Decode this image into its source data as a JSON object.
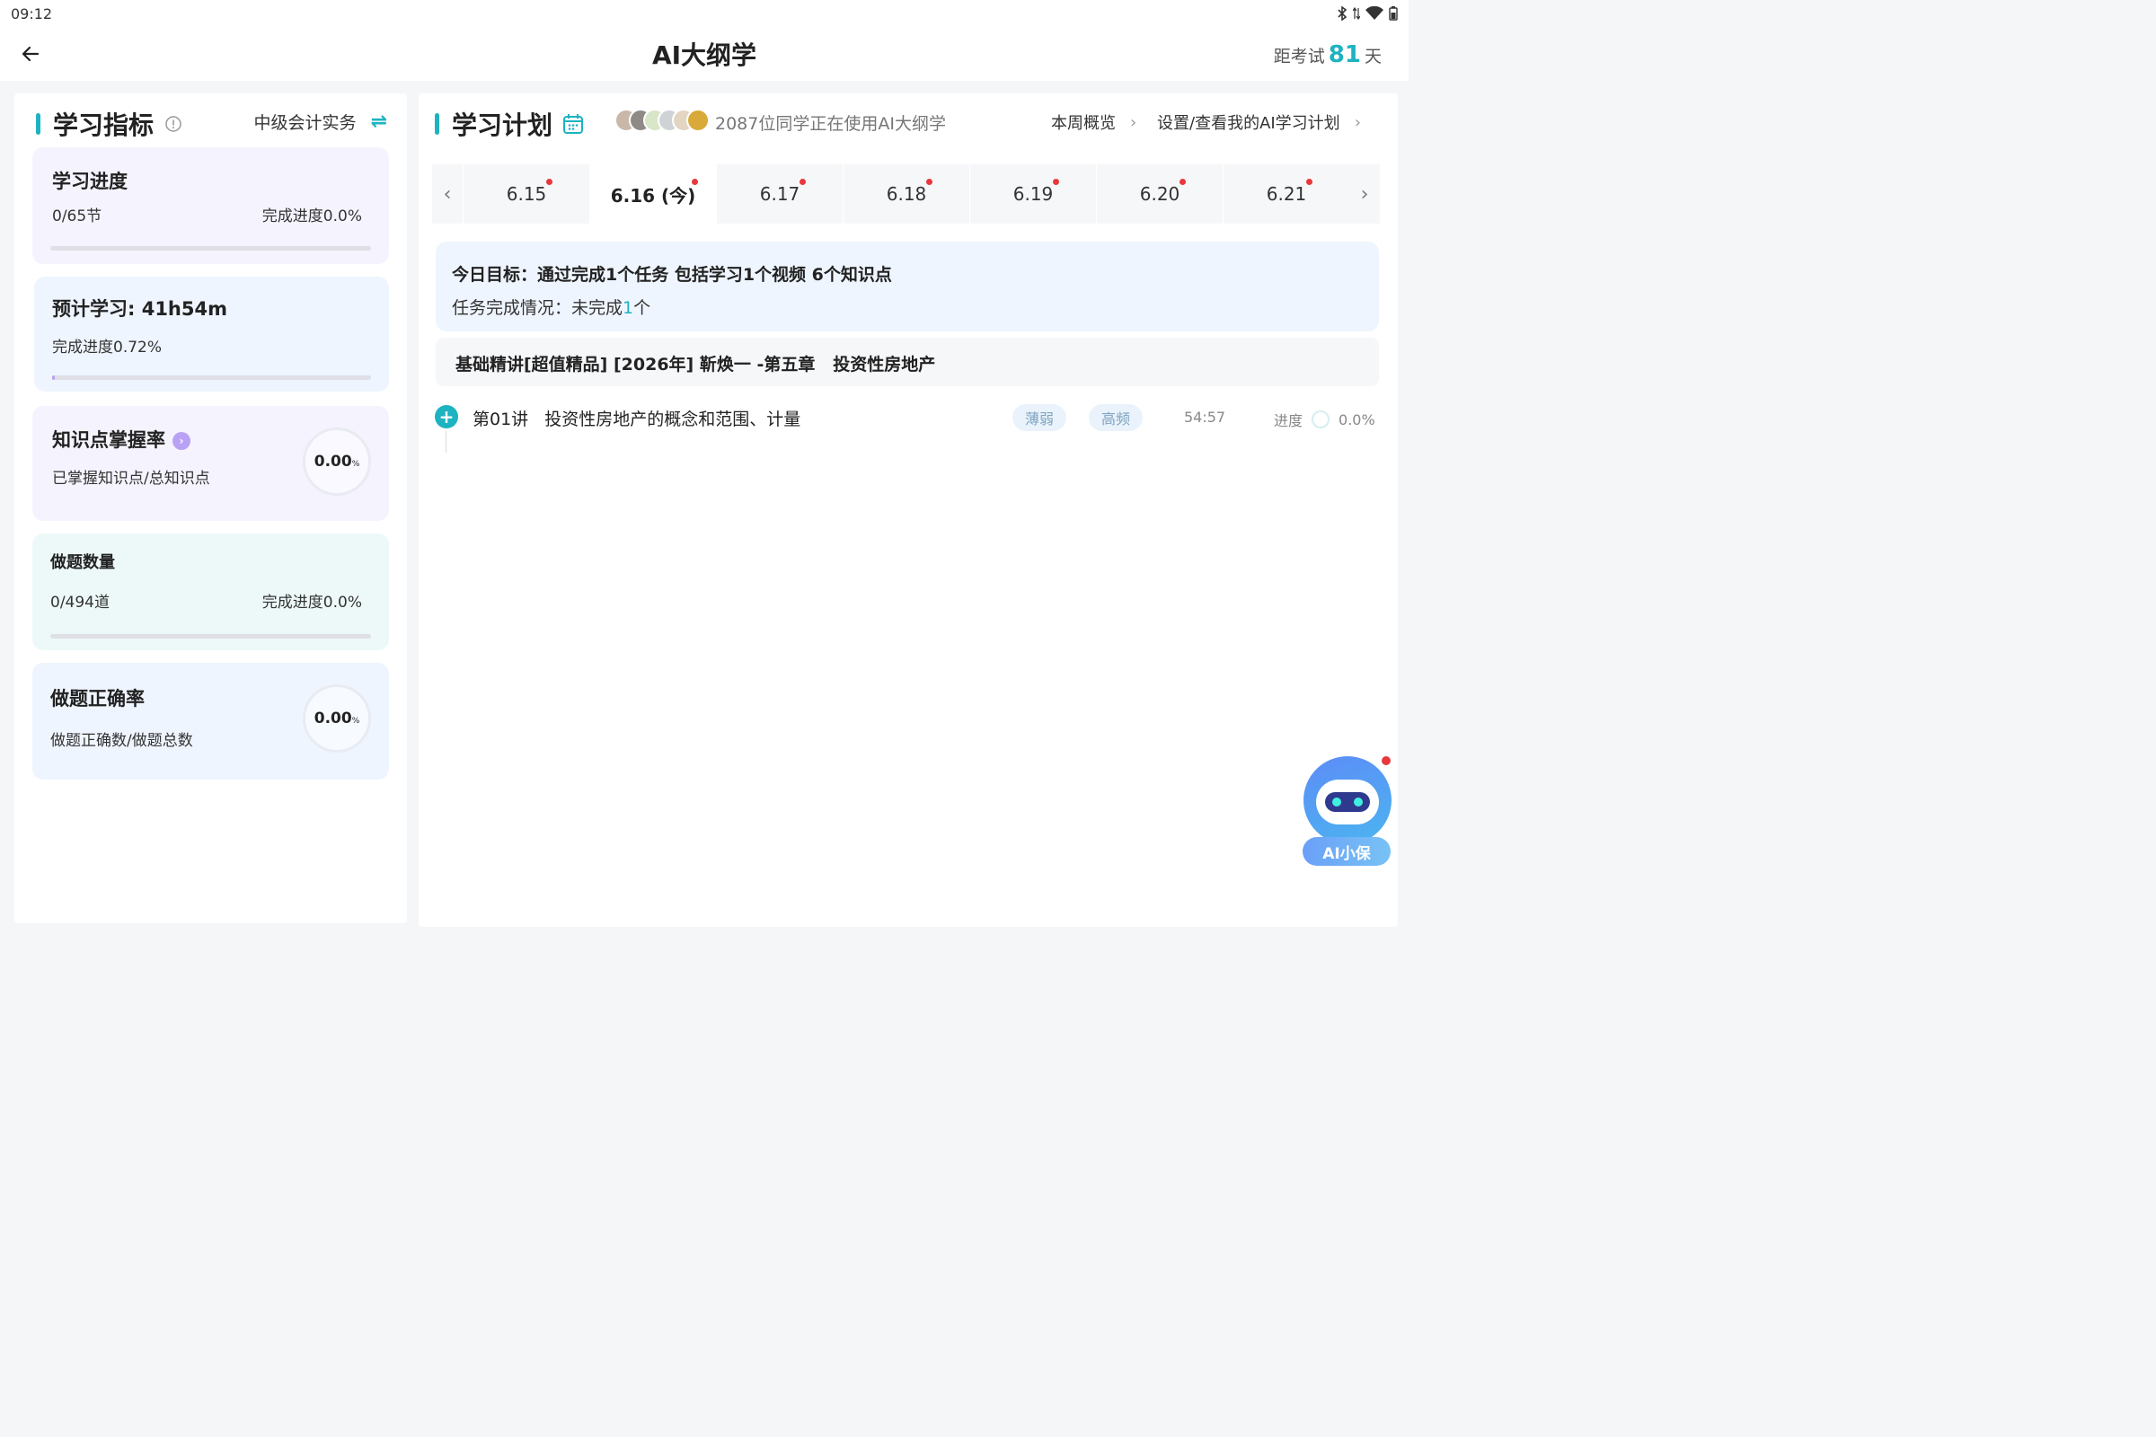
{
  "status_bar": {
    "time": "09:12"
  },
  "header": {
    "title": "AI大纲学",
    "countdown_prefix": "距考试",
    "countdown_days": "81",
    "countdown_suffix": "天"
  },
  "metrics": {
    "title": "学习指标",
    "course": "中级会计实务",
    "study_progress": {
      "title": "学习进度",
      "count": "0/65节",
      "percent_label": "完成进度0.0%",
      "fill": 0.0
    },
    "estimated": {
      "title": "预计学习: 41h54m",
      "percent_label": "完成进度0.72%",
      "fill": 0.0072
    },
    "mastery": {
      "title": "知识点掌握率",
      "subtitle": "已掌握知识点/总知识点",
      "value": "0.00",
      "unit": "%"
    },
    "questions": {
      "title": "做题数量",
      "count": "0/494道",
      "percent_label": "完成进度0.0%",
      "fill": 0.0
    },
    "accuracy": {
      "title": "做题正确率",
      "subtitle": "做题正确数/做题总数",
      "value": "0.00",
      "unit": "%"
    }
  },
  "plan": {
    "title": "学习计划",
    "users_text": "2087位同学正在使用AI大纲学",
    "week_overview": "本周概览",
    "settings_link": "设置/查看我的AI学习计划",
    "dates": [
      "6.15",
      "6.16 (今)",
      "6.17",
      "6.18",
      "6.19",
      "6.20",
      "6.21"
    ],
    "active_date_index": 1,
    "goal": "今日目标：通过完成1个任务 包括学习1个视频 6个知识点",
    "status_prefix": "任务完成情况：未完成",
    "status_count": "1",
    "status_suffix": "个",
    "section_title": "基础精讲[超值精品] [2026年] 靳焕一 -第五章   投资性房地产",
    "lesson": {
      "title": "第01讲   投资性房地产的概念和范围、计量",
      "tag1": "薄弱",
      "tag2": "高频",
      "duration": "54:57",
      "progress_label": "进度",
      "progress_value": "0.0%"
    }
  },
  "assistant": {
    "label": "AI小保"
  },
  "colors": {
    "accent": "#1db3c0",
    "dot": "#e8383d"
  }
}
